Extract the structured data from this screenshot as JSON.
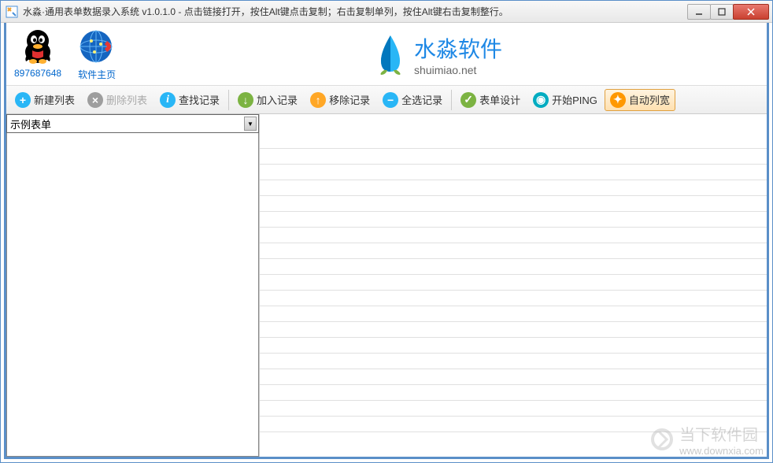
{
  "titlebar": {
    "text": "水淼·通用表单数据录入系统 v1.0.1.0 - 点击链接打开，按住Alt键点击复制；右击复制单列，按住Alt键右击复制整行。"
  },
  "header": {
    "qq_label": "897687648",
    "home_label": "软件主页",
    "logo_main": "水淼软件",
    "logo_sub": "shuimiao.net"
  },
  "toolbar": {
    "new_list": "新建列表",
    "delete_list": "删除列表",
    "find_record": "查找记录",
    "add_record": "加入记录",
    "remove_record": "移除记录",
    "select_all": "全选记录",
    "form_design": "表单设计",
    "start_ping": "开始PING",
    "auto_width": "自动列宽"
  },
  "dropdown": {
    "selected": "示例表单"
  },
  "watermark": {
    "main": "当下软件园",
    "sub": "www.downxia.com"
  }
}
